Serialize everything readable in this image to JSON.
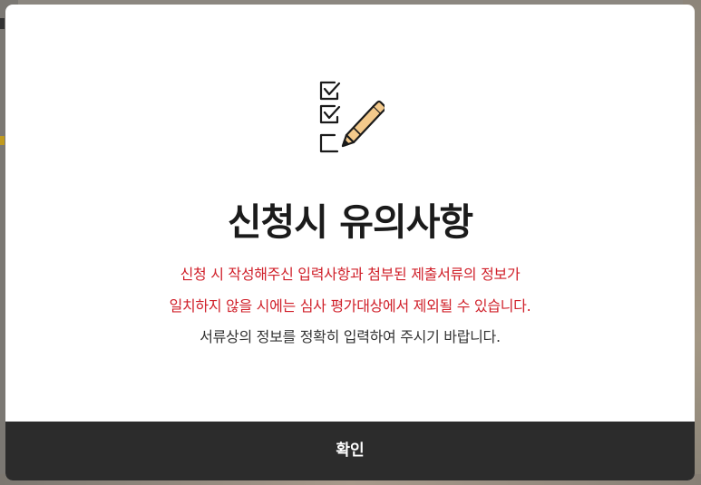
{
  "modal": {
    "title": "신청시 유의사항",
    "warning_line_1": "신청 시 작성해주신 입력사항과 첨부된 제출서류의 정보가",
    "warning_line_2": "일치하지 않을 시에는 심사 평가대상에서 제외될 수 있습니다.",
    "notice_line": "서류상의 정보를 정확히 입력하여 주시기 바랍니다.",
    "confirm_label": "확인",
    "icon": "checklist-pen-icon"
  },
  "colors": {
    "warning_text": "#d0202a",
    "body_text": "#333333",
    "confirm_bg": "#2c2c2c",
    "pen_accent": "#f3c98b"
  }
}
